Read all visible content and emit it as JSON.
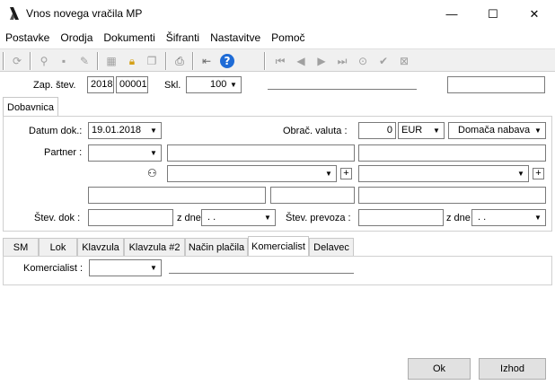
{
  "window": {
    "title": "Vnos novega vračila MP",
    "minimize": "—",
    "maximize": "☐",
    "close": "✕"
  },
  "menu": [
    "Postavke",
    "Orodja",
    "Dokumenti",
    "Šifranti",
    "Nastavitve",
    "Pomoč"
  ],
  "header": {
    "zap_label": "Zap. štev.",
    "zap_year": "2018",
    "zap_number": "00001",
    "skl_label": "Skl.",
    "skl_value": "100"
  },
  "main_tab": "Dobavnica",
  "form": {
    "datum_label": "Datum dok.:",
    "datum_value": "19.01.2018",
    "valuta_label": "Obrač. valuta :",
    "valuta_amount": "0",
    "valuta_code": "EUR",
    "nabava_value": "Domača nabava",
    "partner_label": "Partner :",
    "stev_dok_label": "Štev. dok :",
    "z_dne_label": "z dne",
    "z_dne_value": ". .",
    "stev_prevoza_label": "Štev. prevoza :",
    "z_dne2_label": "z dne",
    "z_dne2_value": ". ."
  },
  "sub_tabs": [
    "SM",
    "Lok",
    "Klavzula",
    "Klavzula #2",
    "Način plačila",
    "Komercialist",
    "Delavec"
  ],
  "active_sub_tab": "Komercialist",
  "komercialist": {
    "label": "Komercialist :"
  },
  "buttons": {
    "ok": "Ok",
    "cancel": "Izhod"
  }
}
